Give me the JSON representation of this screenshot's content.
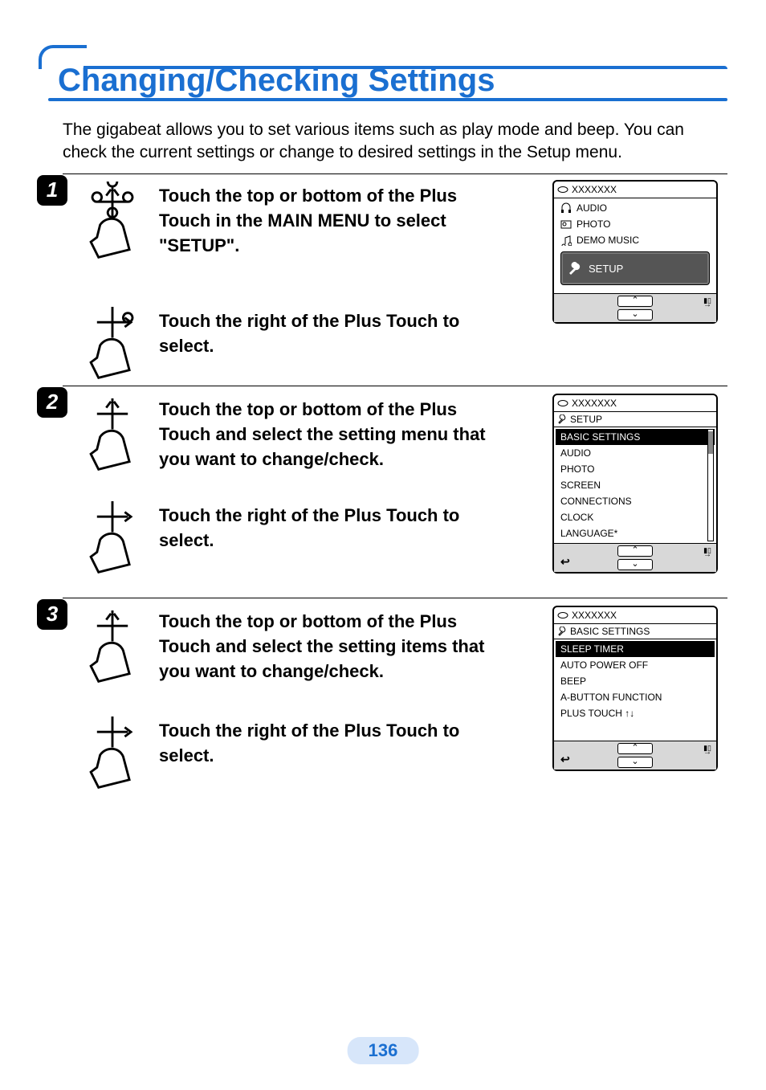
{
  "page": {
    "title": "Changing/Checking Settings",
    "intro": "The gigabeat allows you to set various items such as play mode and beep. You can check the current settings or change to desired settings in the Setup menu.",
    "number": "136"
  },
  "steps": [
    {
      "num": "1",
      "a": "Touch the top or bottom of the Plus Touch in the MAIN MENU to select \"SETUP\".",
      "b": "Touch the right of the Plus Touch to select."
    },
    {
      "num": "2",
      "a": "Touch the top or bottom of the Plus Touch and select the setting menu that you want to change/check.",
      "b": "Touch the right of the Plus Touch to select."
    },
    {
      "num": "3",
      "a": "Touch the top or bottom of the Plus Touch and select the setting items that you want to change/check.",
      "b": "Touch the right of the Plus Touch to select."
    }
  ],
  "screens": {
    "main_menu": {
      "title": "XXXXXXX",
      "items": [
        "AUDIO",
        "PHOTO",
        "DEMO MUSIC"
      ],
      "highlight": "SETUP"
    },
    "setup_menu": {
      "title": "XXXXXXX",
      "breadcrumb": "SETUP",
      "highlight": "BASIC SETTINGS",
      "items": [
        "AUDIO",
        "PHOTO",
        "SCREEN",
        "CONNECTIONS",
        "CLOCK",
        "LANGUAGE*"
      ]
    },
    "basic_menu": {
      "title": "XXXXXXX",
      "breadcrumb": "BASIC SETTINGS",
      "highlight": "SLEEP TIMER",
      "items": [
        "AUTO POWER OFF",
        "BEEP",
        "A-BUTTON FUNCTION",
        "PLUS TOUCH ↑↓"
      ]
    }
  },
  "icons": {
    "disc": "disc-icon",
    "wrench": "wrench-icon",
    "back": "↩",
    "up": "⌃",
    "down": "⌄",
    "fwd": "→",
    "batt": "▮▯"
  }
}
